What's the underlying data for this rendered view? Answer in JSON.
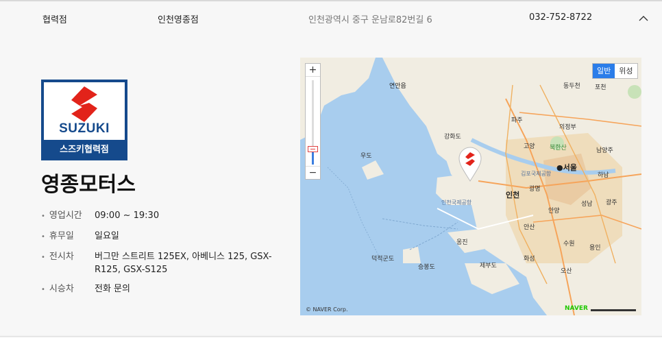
{
  "header": {
    "type": "협력점",
    "name": "인천영종점",
    "address": "인천광역시 중구 운남로82번길 6",
    "phone": "032-752-8722",
    "toggle_icon": "chevron-up-icon"
  },
  "logo": {
    "brand": "SUZUKI",
    "sub": "스즈키협력점",
    "colors": {
      "blue": "#154a8c",
      "red": "#e2231a"
    }
  },
  "dealer": {
    "name": "영종모터스",
    "info": [
      {
        "label": "영업시간",
        "value": "09:00 ~ 19:30"
      },
      {
        "label": "휴무일",
        "value": "일요일"
      },
      {
        "label": "전시차",
        "value": "버그만 스트리트 125EX, 아베니스 125, GSX-R125, GSX-S125"
      },
      {
        "label": "시승차",
        "value": "전화 문의"
      }
    ]
  },
  "map": {
    "zoom_in": "+",
    "zoom_out": "−",
    "type_normal": "일반",
    "type_satellite": "위성",
    "labels": {
      "yeonan": "연안읍",
      "ganghwa": "강화도",
      "udo": "우도",
      "paju": "파주",
      "goyang": "고양",
      "uijeongbu": "의정부",
      "seoul": "●서울",
      "namyangju": "남양주",
      "hanam": "하남",
      "gimpo_airport": "김포국제공항",
      "gwangmyeong": "광명",
      "incheon": "인천",
      "incheon_airport": "인천국제공항",
      "anyang": "안양",
      "seongnam": "성남",
      "gwangju": "광주",
      "ansan": "안산",
      "suwon": "수원",
      "yongin": "용인",
      "yeongjin": "옹진",
      "deokjeok": "덕적군도",
      "seungbong": "승봉도",
      "jebu": "제부도",
      "hwaseong": "화성",
      "osan": "오산",
      "dongducheon": "동두천",
      "pocheon": "포천",
      "bukhansan": "북한산"
    },
    "copyright": "© NAVER Corp.",
    "naver": "NAVER"
  }
}
